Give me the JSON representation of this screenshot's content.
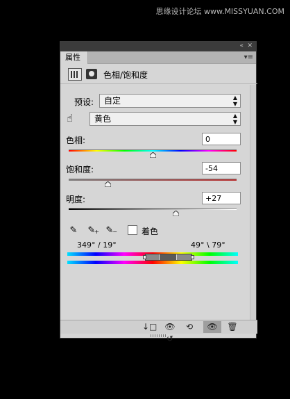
{
  "watermark": "思缘设计论坛 www.MISSYUAN.COM",
  "panel": {
    "collapse_icon": "«",
    "close_icon": "✕",
    "tab_label": "属性",
    "menu_icon": "▾≡",
    "title": "色相/饱和度"
  },
  "preset": {
    "label": "预设:",
    "value": "自定"
  },
  "channel": {
    "value": "黄色"
  },
  "sliders": {
    "hue": {
      "label": "色相:",
      "value": "0",
      "position": 0.5
    },
    "saturation": {
      "label": "饱和度:",
      "value": "-54",
      "position": 0.23
    },
    "lightness": {
      "label": "明度:",
      "value": "+27",
      "position": 0.635
    }
  },
  "colorize": {
    "label": "着色",
    "checked": false
  },
  "range": {
    "left_readout": "349° / 19°",
    "right_readout": "49° \\ 79°"
  },
  "toolbar": {
    "clip_icon": "↓□",
    "view_prev_icon": "👁↺",
    "reset_icon": "⟲",
    "visibility_icon": "👁",
    "delete_icon": "🗑"
  },
  "colors": {
    "panel_bg": "#d6d6d6",
    "topbar_bg": "#3b3b3b",
    "page_bg": "#000000"
  }
}
